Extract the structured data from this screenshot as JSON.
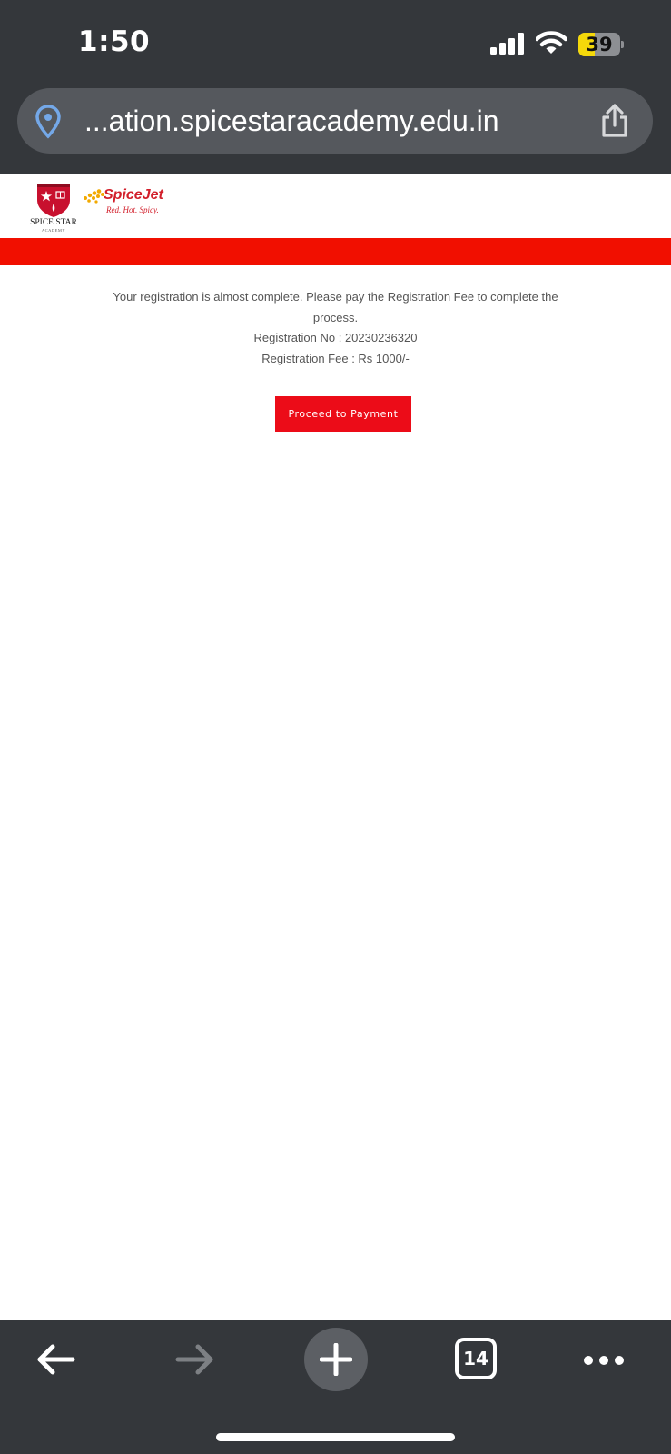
{
  "status_bar": {
    "time": "1:50",
    "battery_level": "39",
    "battery_fraction": 0.39
  },
  "browser": {
    "url": "...ation.spicestaracademy.edu.in",
    "tab_count": "14"
  },
  "header": {
    "brand_name": "SPICE STAR",
    "brand_sub": "ACADEMY",
    "partner_name": "SpiceJet",
    "partner_tagline": "Red. Hot. Spicy."
  },
  "message": {
    "line1": "Your registration is almost complete. Please pay the Registration Fee to complete the process.",
    "registration_no": "Registration No : 20230236320",
    "registration_fee": "Registration Fee : Rs 1000/-"
  },
  "actions": {
    "proceed_label": "Proceed to Payment"
  },
  "colors": {
    "chrome": "#34373b",
    "url_bar": "#55585d",
    "brand_red": "#f10f00",
    "button_red": "#ec0c18",
    "battery_yellow": "#f5d90a"
  },
  "icons": {
    "location": "location-pin-icon",
    "share": "share-icon",
    "back": "arrow-left-icon",
    "forward": "arrow-right-icon",
    "new_tab": "plus-icon",
    "more": "ellipsis-icon"
  }
}
